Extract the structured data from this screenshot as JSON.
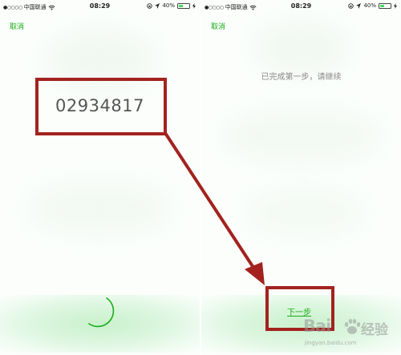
{
  "left_screen": {
    "status_bar": {
      "signal": "●○○○○",
      "carrier": "中国联通",
      "time": "08:29",
      "battery_percent": "40%",
      "battery_level": 0.4
    },
    "cancel_label": "取消",
    "verification_code": "02934817"
  },
  "right_screen": {
    "status_bar": {
      "signal": "●○○○○",
      "carrier": "中国联通",
      "time": "08:29",
      "battery_percent": "40%",
      "battery_level": 0.4
    },
    "cancel_label": "取消",
    "message": "已完成第一步，请继续",
    "next_step_label": "下一步"
  },
  "annotation": {
    "color": "#a3221e"
  },
  "watermark": {
    "logo_text": "Bai",
    "logo_cn": "经验",
    "url": "jingyan.baidu.com"
  },
  "colors": {
    "accent_green": "#1aad19"
  }
}
